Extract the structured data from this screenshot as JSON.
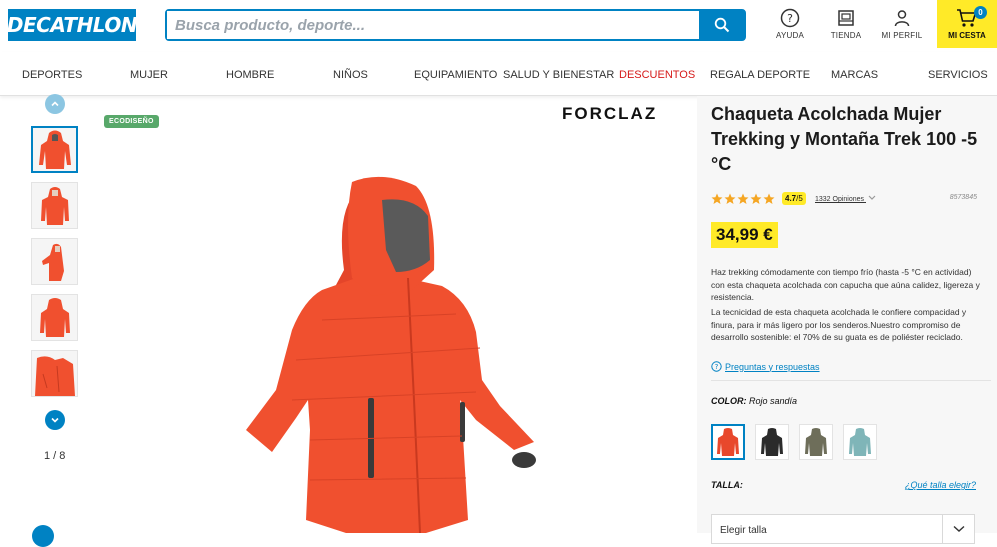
{
  "header": {
    "logo": "DECATHLON",
    "search_placeholder": "Busca producto, deporte...",
    "icons": [
      {
        "name": "help",
        "label": "AYUDA"
      },
      {
        "name": "store",
        "label": "TIENDA"
      },
      {
        "name": "profile",
        "label": "MI PERFIL"
      }
    ],
    "cart": {
      "label": "MI CESTA",
      "count": "0"
    }
  },
  "nav": [
    "DEPORTES",
    "MUJER",
    "HOMBRE",
    "NIÑOS",
    "EQUIPAMIENTO",
    "SALUD Y BIENESTAR",
    "DESCUENTOS",
    "REGALA DEPORTE",
    "MARCAS",
    "SERVICIOS"
  ],
  "gallery": {
    "counter": "1 / 8",
    "eco_badge": "ECODISEÑO",
    "brand": "FORCLAZ"
  },
  "product": {
    "title": "Chaqueta Acolchada Mujer Trekking y Montaña Trek 100 -5 °C",
    "rating": "4.7",
    "rating_scale": "/5",
    "reviews": "1332 Opiniones",
    "ref": "8573845",
    "price": "34,99 €",
    "description_1": "Haz trekking cómodamente con tiempo frío (hasta -5 °C en actividad) con esta chaqueta acolchada con capucha que aúna calidez, ligereza y resistencia.",
    "description_2": "La tecnicidad de esta chaqueta acolchada le confiere compacidad y finura, para ir más ligero por los senderos.Nuestro compromiso de desarrollo sostenible: el 70% de su guata es de poliéster reciclado.",
    "qa_link": "Preguntas y respuestas",
    "color_label": "COLOR:",
    "color_value": "Rojo sandía",
    "swatch_colors": [
      "#e8482c",
      "#2b2b2b",
      "#6e6e5a",
      "#7fb5b8"
    ],
    "size_label": "TALLA:",
    "size_guide": "¿Qué talla elegir?",
    "size_placeholder": "Elegir talla"
  },
  "colors": {
    "brand_blue": "#0082c3",
    "yellow": "#ffea28",
    "jacket": "#f0502f"
  }
}
